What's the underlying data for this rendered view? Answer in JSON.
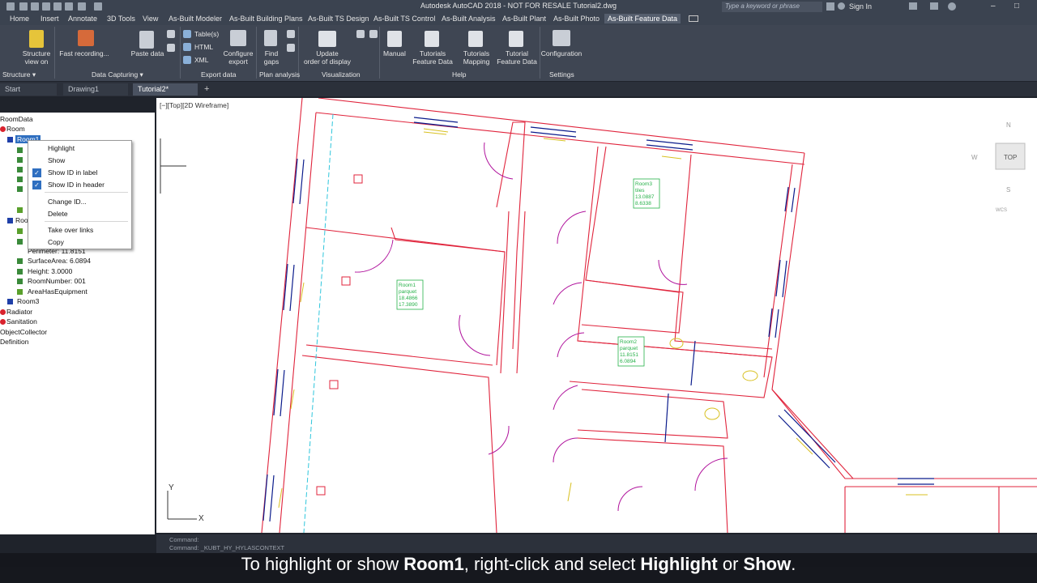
{
  "window": {
    "title": "Autodesk AutoCAD 2018 - NOT FOR RESALE   Tutorial2.dwg"
  },
  "search": {
    "placeholder": "Type a keyword or phrase"
  },
  "account": {
    "sign_in": "Sign In"
  },
  "ribbon_tabs": [
    "Home",
    "Insert",
    "Annotate",
    "3D Tools",
    "View",
    "As-Built Modeler",
    "As-Built Building Plans",
    "As-Built TS Design",
    "As-Built TS Control",
    "As-Built Analysis",
    "As-Built Plant",
    "As-Built Photo",
    "As-Built Feature Data"
  ],
  "ribbon": {
    "buttons": {
      "structure_view": "Structure\nview on",
      "fast_recording": "Fast recording...",
      "paste_data": "Paste data",
      "tables": "Table(s)",
      "html": "HTML",
      "xml": "XML",
      "configure_export": "Configure\nexport",
      "find_gaps": "Find\ngaps",
      "update_order": "Update\norder of display",
      "manual": "Manual",
      "tutorials_feature": "Tutorials\nFeature Data",
      "tutorials_mapping": "Tutorials\nMapping",
      "tutorial_feature": "Tutorial\nFeature Data",
      "configuration": "Configuration"
    },
    "panels": {
      "structure": "Structure",
      "data_capturing": "Data Capturing",
      "export_data": "Export data",
      "plan_analysis": "Plan analysis",
      "visualization": "Visualization",
      "help": "Help",
      "settings": "Settings"
    }
  },
  "doc_tabs": [
    "Start",
    "Drawing1",
    "Tutorial2*"
  ],
  "tree": {
    "root": "RoomData",
    "room": "Room",
    "room1": "Room1",
    "room2": "Room",
    "perimeter": "Perimeter: 11.8151",
    "surface": "SurfaceArea: 6.0894",
    "height": "Height: 3.0000",
    "roomnumber": "RoomNumber: 001",
    "equipment": "AreaHasEquipment",
    "room3": "Room3",
    "radiator": "Radiator",
    "sanitation": "Sanitation",
    "objcollector": "ObjectCollector",
    "definition": "Definition"
  },
  "context_menu": {
    "highlight": "Highlight",
    "show": "Show",
    "show_id_label": "Show ID in label",
    "show_id_header": "Show ID in header",
    "change_id": "Change ID...",
    "delete": "Delete",
    "take_over": "Take over links",
    "copy": "Copy"
  },
  "viewport": {
    "label": "[−][Top][2D Wireframe]",
    "viewcube_top": "TOP",
    "viewcube_n": "N",
    "viewcube_w": "W",
    "viewcube_s": "S",
    "wcs": "WCS",
    "axis_x": "X",
    "axis_y": "Y"
  },
  "rooms": {
    "room1": [
      "Room1",
      "parquet",
      "18.4866",
      "17.3890"
    ],
    "room2": [
      "Room2",
      "parquet",
      "11.8151",
      "6.0894"
    ],
    "room3": [
      "Room3",
      "tiles",
      "13.0887",
      "8.6338"
    ]
  },
  "command": {
    "line1": "Command:",
    "line2": "Command:  _KUBT_HY_HYLASCONTEXT"
  },
  "caption": {
    "p1": "To highlight or show ",
    "b1": "Room1",
    "p2": ", right-click and select ",
    "b2": "Highlight",
    "p3": " or ",
    "b3": "Show",
    "p4": "."
  },
  "colors": {
    "accent": "#2f6fc0",
    "wall": "#e0243c",
    "door": "#b0129c",
    "room_label": "#27b14a"
  }
}
